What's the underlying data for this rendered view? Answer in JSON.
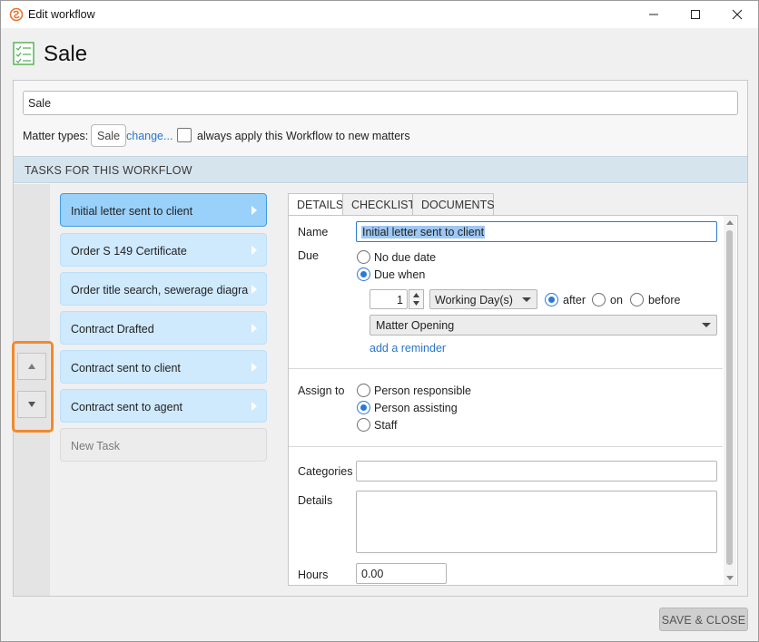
{
  "window": {
    "title": "Edit workflow"
  },
  "header": {
    "title": "Sale"
  },
  "workflow": {
    "name_value": "Sale",
    "matter_types_label": "Matter types:",
    "matter_type_chip": "Sale",
    "change_link": "change...",
    "always_apply_label": "always apply this Workflow to new matters",
    "always_apply_checked": false
  },
  "tasks_section": {
    "title": "TASKS FOR THIS WORKFLOW",
    "tasks": [
      {
        "label": "Initial letter sent to client",
        "active": true
      },
      {
        "label": "Order S 149 Certificate"
      },
      {
        "label": "Order title search, sewerage diagra..."
      },
      {
        "label": "Contract Drafted"
      },
      {
        "label": "Contract sent to client"
      },
      {
        "label": "Contract sent to agent"
      }
    ],
    "new_task_label": "New Task"
  },
  "detail_tabs": [
    "DETAILS",
    "CHECKLIST",
    "DOCUMENTS"
  ],
  "details": {
    "name_label": "Name",
    "name_value": "Initial letter sent to client",
    "due_label": "Due",
    "no_due_date": "No due date",
    "due_when": "Due when",
    "quantity": "1",
    "unit": "Working Day(s)",
    "after": "after",
    "on": "on",
    "before": "before",
    "event": "Matter Opening",
    "add_reminder": "add a reminder",
    "assign_label": "Assign to",
    "assign_options": [
      "Person responsible",
      "Person assisting",
      "Staff"
    ],
    "categories_label": "Categories",
    "details_label": "Details",
    "hours_label": "Hours",
    "hours_value": "0.00"
  },
  "footer": {
    "save_close": "SAVE & CLOSE"
  },
  "colors": {
    "accent": "#2a79d6",
    "task_active": "#99d1fb",
    "task_bg": "#cfe9fd",
    "highlight": "#f2892a"
  }
}
